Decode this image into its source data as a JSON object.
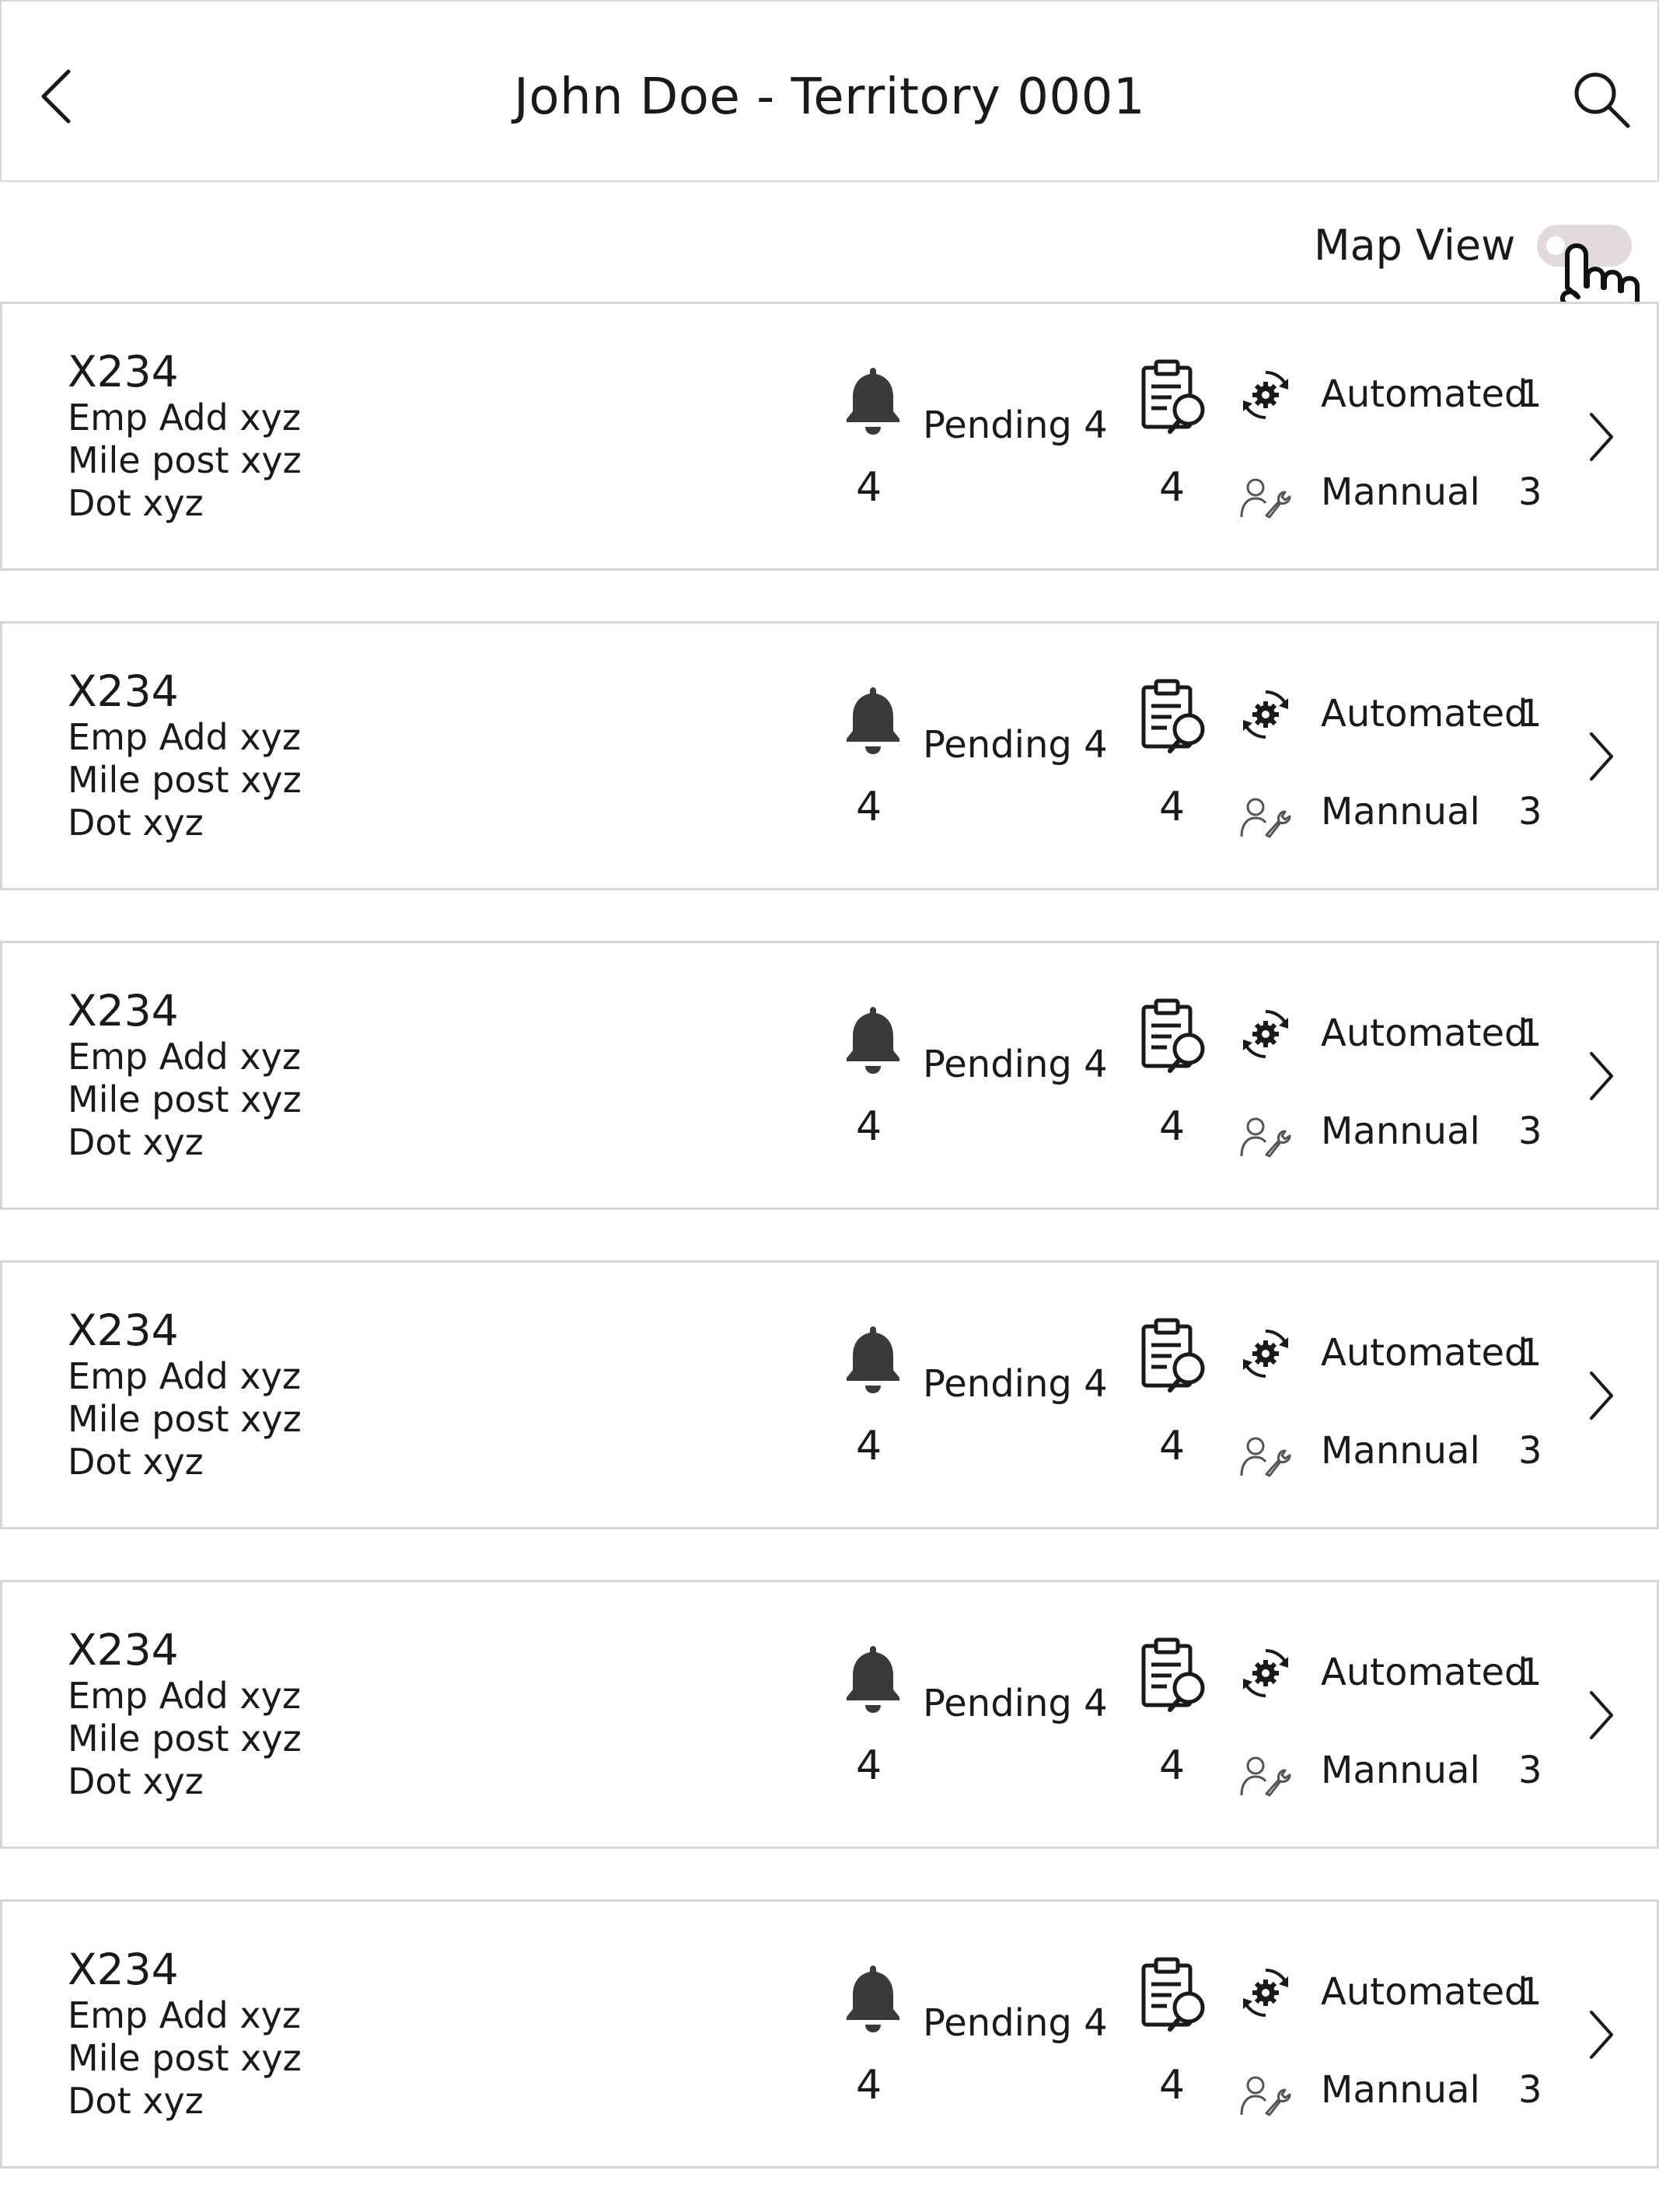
{
  "header": {
    "title": "John Doe - Territory 0001",
    "back_icon": "chevron-left-icon",
    "search_icon": "search-icon"
  },
  "map_view": {
    "label": "Map View",
    "enabled": false
  },
  "labels": {
    "pending": "Pending 4",
    "automated": "Automated",
    "manual": "Mannual"
  },
  "cards": [
    {
      "code": "X234",
      "emp_add": "Emp Add xyz",
      "mile_post": "Mile post xyz",
      "dot": "Dot xyz",
      "alerts": "4",
      "pending": "Pending 4",
      "inspections": "4",
      "automated_label": "Automated",
      "automated": "1",
      "manual_label": "Mannual",
      "manual": "3"
    },
    {
      "code": "X234",
      "emp_add": "Emp Add xyz",
      "mile_post": "Mile post xyz",
      "dot": "Dot xyz",
      "alerts": "4",
      "pending": "Pending 4",
      "inspections": "4",
      "automated_label": "Automated",
      "automated": "1",
      "manual_label": "Mannual",
      "manual": "3"
    },
    {
      "code": "X234",
      "emp_add": "Emp Add xyz",
      "mile_post": "Mile post xyz",
      "dot": "Dot xyz",
      "alerts": "4",
      "pending": "Pending 4",
      "inspections": "4",
      "automated_label": "Automated",
      "automated": "1",
      "manual_label": "Mannual",
      "manual": "3"
    },
    {
      "code": "X234",
      "emp_add": "Emp Add xyz",
      "mile_post": "Mile post xyz",
      "dot": "Dot xyz",
      "alerts": "4",
      "pending": "Pending 4",
      "inspections": "4",
      "automated_label": "Automated",
      "automated": "1",
      "manual_label": "Mannual",
      "manual": "3"
    },
    {
      "code": "X234",
      "emp_add": "Emp Add xyz",
      "mile_post": "Mile post xyz",
      "dot": "Dot xyz",
      "alerts": "4",
      "pending": "Pending 4",
      "inspections": "4",
      "automated_label": "Automated",
      "automated": "1",
      "manual_label": "Mannual",
      "manual": "3"
    },
    {
      "code": "X234",
      "emp_add": "Emp Add xyz",
      "mile_post": "Mile post xyz",
      "dot": "Dot xyz",
      "alerts": "4",
      "pending": "Pending 4",
      "inspections": "4",
      "automated_label": "Automated",
      "automated": "1",
      "manual_label": "Mannual",
      "manual": "3"
    }
  ],
  "colors": {
    "border": "#d6d6d6",
    "toggle_track": "#e2dada",
    "text": "#1a1a1a"
  }
}
